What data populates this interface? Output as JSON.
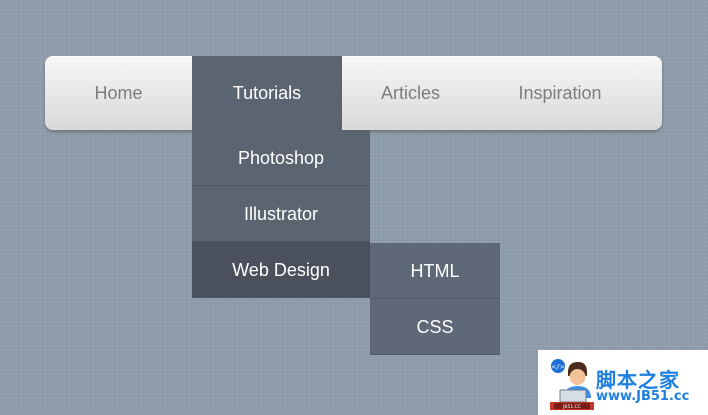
{
  "navbar": {
    "items": [
      {
        "label": "Home"
      },
      {
        "label": "Tutorials",
        "active": true
      },
      {
        "label": "Articles"
      },
      {
        "label": "Inspiration"
      }
    ]
  },
  "dropdown": {
    "items": [
      {
        "label": "Photoshop"
      },
      {
        "label": "Illustrator"
      },
      {
        "label": "Web Design",
        "active": true
      }
    ]
  },
  "submenu": {
    "items": [
      {
        "label": "HTML"
      },
      {
        "label": "CSS"
      }
    ]
  },
  "watermark": {
    "title": "脚本之家",
    "url": "www.JB51.cc",
    "logo_text": "JB51.CC",
    "logo_icon": "developer-at-laptop-icon"
  },
  "colors": {
    "background": "#8e9caa",
    "active_menu": "#5b6471",
    "active_dropdown_item": "#4a515c",
    "inactive_text": "#7d7d7d",
    "brand_blue": "#1d7fe0"
  }
}
